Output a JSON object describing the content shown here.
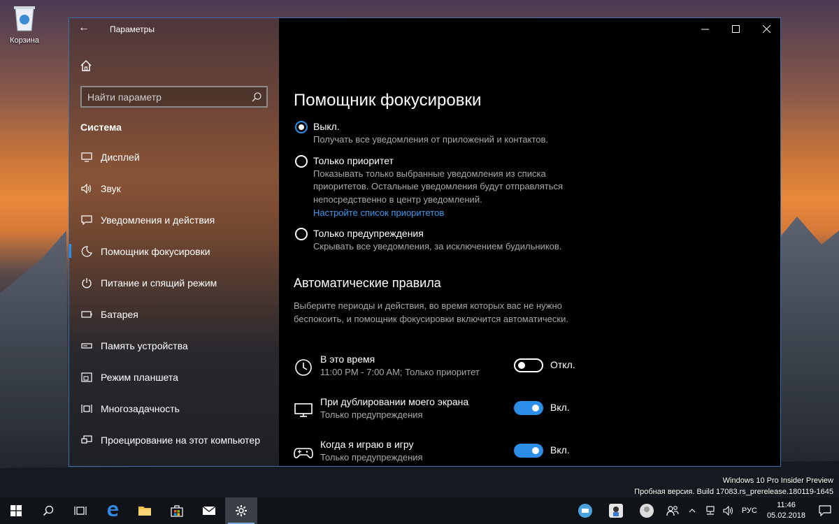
{
  "desktop": {
    "recycle_bin_label": "Корзина"
  },
  "window": {
    "title": "Параметры",
    "search_placeholder": "Найти параметр",
    "section": "Система",
    "nav": [
      {
        "label": "Дисплей",
        "icon": "display-icon"
      },
      {
        "label": "Звук",
        "icon": "speaker-icon"
      },
      {
        "label": "Уведомления и действия",
        "icon": "notification-icon"
      },
      {
        "label": "Помощник фокусировки",
        "icon": "moon-icon",
        "active": true
      },
      {
        "label": "Питание и спящий режим",
        "icon": "power-icon"
      },
      {
        "label": "Батарея",
        "icon": "battery-icon"
      },
      {
        "label": "Память устройства",
        "icon": "storage-icon"
      },
      {
        "label": "Режим планшета",
        "icon": "tablet-icon"
      },
      {
        "label": "Многозадачность",
        "icon": "multitask-icon"
      },
      {
        "label": "Проецирование на этот компьютер",
        "icon": "project-icon"
      }
    ]
  },
  "content": {
    "title": "Помощник фокусировки",
    "options": [
      {
        "label": "Выкл.",
        "desc": "Получать все уведомления от приложений и контактов.",
        "selected": true
      },
      {
        "label": "Только приоритет",
        "desc": "Показывать только выбранные уведомления из списка приоритетов. Остальные уведомления будут отправляться непосредственно в центр уведомлений.",
        "link": "Настройте список приоритетов",
        "selected": false
      },
      {
        "label": "Только предупреждения",
        "desc": "Скрывать все уведомления, за исключением будильников.",
        "selected": false
      }
    ],
    "auto_rules_title": "Автоматические правила",
    "auto_rules_desc": "Выберите периоды и действия, во время которых вас не нужно беспокоить, и помощник фокусировки включится автоматически.",
    "rules": [
      {
        "name": "В это время",
        "sub": "11:00 PM - 7:00 AM; Только приоритет",
        "state": "Откл.",
        "on": false,
        "icon": "clock-icon"
      },
      {
        "name": "При дублировании моего экрана",
        "sub": "Только предупреждения",
        "state": "Вкл.",
        "on": true,
        "icon": "monitor-icon"
      },
      {
        "name": "Когда я играю в игру",
        "sub": "Только предупреждения",
        "state": "Вкл.",
        "on": true,
        "icon": "gamepad-icon"
      }
    ]
  },
  "watermark": {
    "line1": "Windows 10 Pro Insider Preview",
    "line2": "Пробная версия. Build 17083.rs_prerelease.180119-1645"
  },
  "taskbar": {
    "lang": "РУС",
    "time": "11:46",
    "date": "05.02.2018"
  },
  "colors": {
    "accent": "#2c8ee6",
    "link": "#3a9af0"
  }
}
